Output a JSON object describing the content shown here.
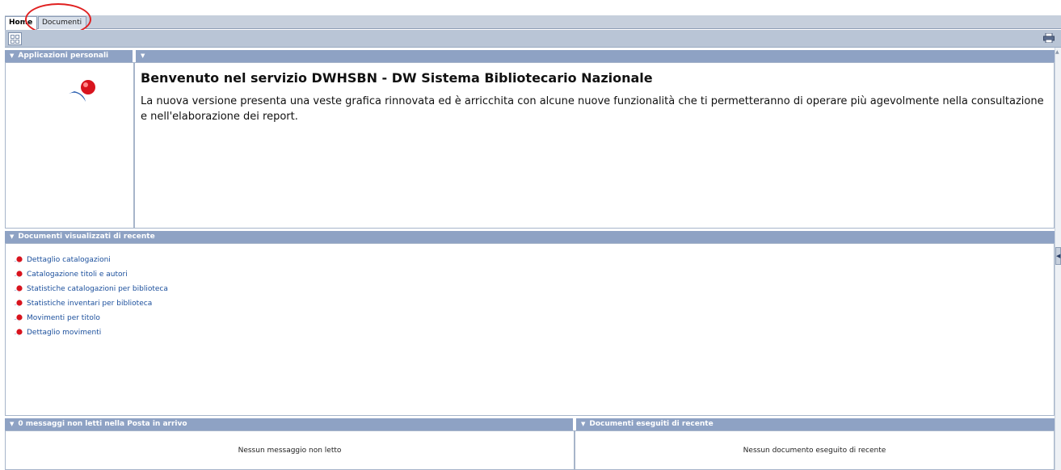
{
  "tabs": [
    {
      "label": "Home",
      "active": true
    },
    {
      "label": "Documenti",
      "active": false
    }
  ],
  "toolbar": {
    "grid_icon": "grid-view-icon",
    "print_icon": "print-icon"
  },
  "panels": {
    "personal_apps": {
      "title": "Applicazioni personali"
    },
    "welcome": {
      "title": "Benvenuto nel servizio DWHSBN - DW Sistema Bibliotecario Nazionale",
      "text": "La nuova versione presenta una veste grafica rinnovata ed è arricchita con alcune nuove funzionalità che ti permetteranno di operare più agevolmente nella consultazione e nell'elaborazione dei report."
    },
    "recent_docs": {
      "title": "Documenti visualizzati di recente",
      "items": [
        "Dettaglio catalogazioni",
        "Catalogazione titoli e autori",
        "Statistiche catalogazioni per biblioteca",
        "Statistiche inventari per biblioteca",
        "Movimenti per titolo",
        "Dettaglio movimenti"
      ]
    },
    "inbox": {
      "title": "0 messaggi non letti nella Posta in arrivo",
      "empty": "Nessun messaggio non letto"
    },
    "recent_run": {
      "title": "Documenti eseguiti di recente",
      "empty": "Nessun documento eseguito di recente"
    }
  },
  "colors": {
    "header_blue": "#8ea2c4",
    "link_blue": "#1b4f9c",
    "annotation_red": "#e02020"
  }
}
